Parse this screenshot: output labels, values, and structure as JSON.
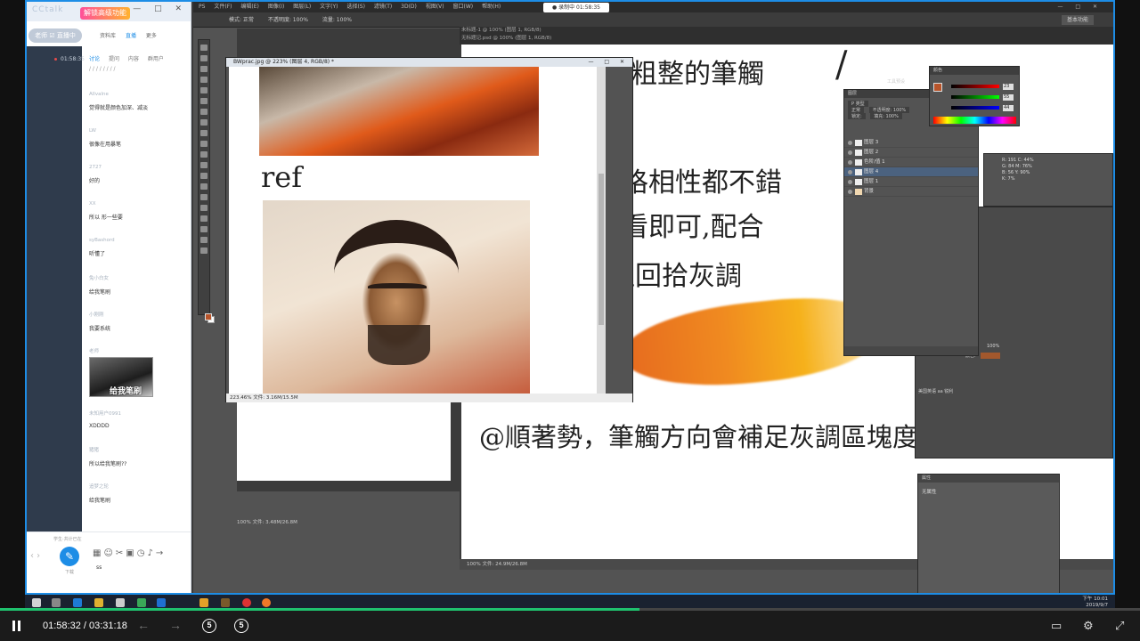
{
  "chat": {
    "logo": "CCtalk",
    "badge": "解锁高级功能",
    "window_controls": "— □ ✕",
    "status_pill": "老师 ☑ 直播中",
    "top_tabs": [
      "资料库",
      "直播",
      "更多"
    ],
    "room_time": "01:58:35",
    "sub_tabs": [
      "讨论",
      "提问",
      "内容",
      "群用户"
    ],
    "first_line": "/ / / / / / / /",
    "messages": [
      {
        "user": "Allvalne",
        "text": "觉得就是颜色加深、减淡"
      },
      {
        "user": "LW",
        "text": "很像在用暴笔"
      },
      {
        "user": "2727",
        "text": "好的"
      },
      {
        "user": "XX",
        "text": "所以 形一些要"
      },
      {
        "user": "syBashord",
        "text": "听懂了"
      },
      {
        "user": "兔小白女",
        "text": "给我笔刷"
      },
      {
        "user": "小刚刚",
        "text": "我要系统"
      },
      {
        "user": "老师",
        "image_caption": "给我笔刷"
      },
      {
        "user": "未知用户0991",
        "text": "XDDDD"
      },
      {
        "user": "猪猪",
        "text": "所以给我笔刷??"
      },
      {
        "user": "追梦之轮",
        "text": "给我笔刷"
      }
    ],
    "online_label": "学生·共计已在",
    "fab_label": "下载",
    "input_text": "ss"
  },
  "photoshop": {
    "menu_items": [
      "PS",
      "文件(F)",
      "编辑(E)",
      "图像(I)",
      "图层(L)",
      "文字(Y)",
      "选择(S)",
      "滤镜(T)",
      "3D(D)",
      "视图(V)",
      "窗口(W)",
      "帮助(H)"
    ],
    "recording_badge": "● 录制中 01:58:35",
    "options": [
      "模式: 正常",
      "不透明度: 100%",
      "流量: 100%"
    ],
    "workspace": "基本功能",
    "doc_tabs": [
      "未标题-1 @ 100% (图层 1, RGB/8)",
      "无标题记.psd @ 100% (图层 1, RGB/8)",
      "未标题-3 @ 100% (图层 1 副本 2, RGB/8)  ×   练习速写.psd @ 156% (图层 1, RGB/8)"
    ],
    "main_status": "100%   文件: 24.9M/26.8M",
    "doc2_status": "100%   文件: 3.48M/26.8M",
    "image_doc": {
      "title": "BWprac.jpg @ 223% (图层 4, RGB/8) *",
      "ref_text": "ref",
      "status": "223.46%   文件: 3.16M/15.5M"
    },
    "handwriting": [
      "後粗整的筆觸",
      "/",
      "回格相性都不錯",
      "誰看即可,配合",
      "往回拾灰調",
      "@順著勢，筆觸方向會補足灰調區塊度"
    ],
    "color_panel": {
      "title": "颜色",
      "values": [
        "23",
        "55",
        "44"
      ]
    },
    "tool_title": "工具预设",
    "layers": {
      "title": "图层",
      "options": [
        "P 类型",
        "正常",
        "不透明度: 100%",
        "锁定:",
        "填充: 100%"
      ],
      "items": [
        {
          "name": "图层 3",
          "selected": false
        },
        {
          "name": "图层 2",
          "selected": false
        },
        {
          "name": "色阶/值 1",
          "selected": false
        },
        {
          "name": "图层 4",
          "selected": true
        },
        {
          "name": "图层 1",
          "selected": false
        },
        {
          "name": "背景",
          "selected": false
        }
      ]
    },
    "info_rows": [
      "R: 191   C: 44%",
      "G: 84    M: 76%",
      "B: 56    Y: 90%",
      "K: 7%"
    ],
    "char_panel": {
      "pct": "100%",
      "color_label": "颜色:",
      "bottom": "美国英语    aa 锐利"
    },
    "props_panel": {
      "title": "属性",
      "body": "无属性"
    }
  },
  "taskbar": {
    "time": "下午 10:01",
    "date": "2019/9/7"
  },
  "player": {
    "current": "01:58:32",
    "total": "03:31:18",
    "progress": 0.561,
    "skip_back": "5",
    "skip_fwd": "5"
  }
}
